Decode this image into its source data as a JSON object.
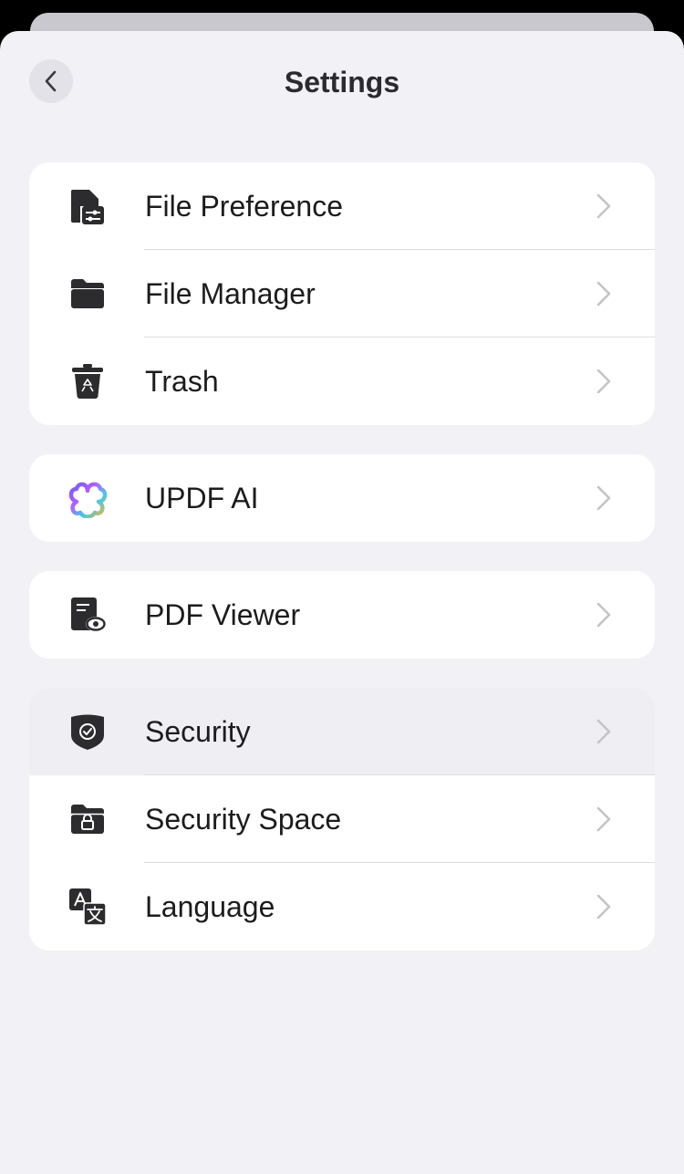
{
  "header": {
    "title": "Settings"
  },
  "groups": [
    {
      "items": [
        {
          "label": "File Preference",
          "icon": "file-preference-icon"
        },
        {
          "label": "File Manager",
          "icon": "folder-icon"
        },
        {
          "label": "Trash",
          "icon": "trash-icon"
        }
      ]
    },
    {
      "items": [
        {
          "label": "UPDF AI",
          "icon": "updf-ai-icon"
        }
      ]
    },
    {
      "items": [
        {
          "label": "PDF Viewer",
          "icon": "pdf-viewer-icon"
        }
      ]
    },
    {
      "items": [
        {
          "label": "Security",
          "icon": "shield-check-icon"
        },
        {
          "label": "Security Space",
          "icon": "lock-folder-icon"
        },
        {
          "label": "Language",
          "icon": "translate-icon"
        }
      ]
    }
  ],
  "colors": {
    "background": "#f2f1f6",
    "card": "#ffffff",
    "icon": "#2c2c2e",
    "chevron": "#c4c4c8"
  }
}
